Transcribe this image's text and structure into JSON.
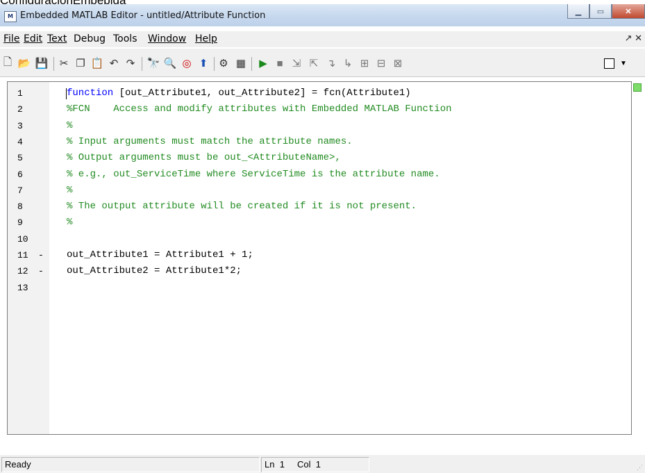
{
  "caption": "ConfiguraciónEmbebida",
  "window": {
    "title": "Embedded MATLAB Editor - untitled/Attribute Function",
    "icon_label": "M",
    "buttons": [
      "minimize-icon",
      "maximize-icon",
      "close-icon"
    ]
  },
  "menu": {
    "items": [
      {
        "label": "File",
        "underline": "F"
      },
      {
        "label": "Edit",
        "underline": "E"
      },
      {
        "label": "Text",
        "underline": "T"
      },
      {
        "label": "Debug",
        "underline": "b"
      },
      {
        "label": "Tools",
        "underline": "o"
      },
      {
        "label": "Window",
        "underline": "W"
      },
      {
        "label": "Help",
        "underline": "H"
      }
    ],
    "undock_label": "↗ ✕"
  },
  "toolbar": {
    "icons": [
      "new-file-icon",
      "open-folder-icon",
      "save-icon",
      "cut-icon",
      "copy-icon",
      "paste-icon",
      "undo-icon",
      "redo-icon",
      "find-icon",
      "find-files-icon",
      "target-icon",
      "go-up-icon",
      "build-icon",
      "data-ports-icon",
      "run-icon",
      "stop-icon",
      "step-in-icon",
      "step-out-icon",
      "step-icon",
      "step-into-icon",
      "breakpoint-icon",
      "clear-breakpoints-icon",
      "exit-debug-icon"
    ]
  },
  "editor": {
    "lines": [
      {
        "num": "1",
        "mark": "",
        "segments": [
          {
            "t": "function",
            "c": "kw"
          },
          {
            "t": " [out_Attribute1, out_Attribute2] = fcn(Attribute1)",
            "c": ""
          }
        ]
      },
      {
        "num": "2",
        "mark": "",
        "segments": [
          {
            "t": "%FCN    Access and modify attributes with Embedded MATLAB Function",
            "c": "cm"
          }
        ]
      },
      {
        "num": "3",
        "mark": "",
        "segments": [
          {
            "t": "%",
            "c": "cm"
          }
        ]
      },
      {
        "num": "4",
        "mark": "",
        "segments": [
          {
            "t": "% Input arguments must match the attribute names.",
            "c": "cm"
          }
        ]
      },
      {
        "num": "5",
        "mark": "",
        "segments": [
          {
            "t": "% Output arguments must be out_<AttributeName>,",
            "c": "cm"
          }
        ]
      },
      {
        "num": "6",
        "mark": "",
        "segments": [
          {
            "t": "% e.g., out_ServiceTime where ServiceTime is the attribute name.",
            "c": "cm"
          }
        ]
      },
      {
        "num": "7",
        "mark": "",
        "segments": [
          {
            "t": "%",
            "c": "cm"
          }
        ]
      },
      {
        "num": "8",
        "mark": "",
        "segments": [
          {
            "t": "% The output attribute will be created if it is not present.",
            "c": "cm"
          }
        ]
      },
      {
        "num": "9",
        "mark": "",
        "segments": [
          {
            "t": "%",
            "c": "cm"
          }
        ]
      },
      {
        "num": "10",
        "mark": "",
        "segments": []
      },
      {
        "num": "11",
        "mark": "-",
        "segments": [
          {
            "t": "out_Attribute1 = Attribute1 + 1;",
            "c": ""
          }
        ]
      },
      {
        "num": "12",
        "mark": "-",
        "segments": [
          {
            "t": "out_Attribute2 = Attribute1*2;",
            "c": ""
          }
        ]
      },
      {
        "num": "13",
        "mark": "",
        "segments": []
      }
    ]
  },
  "status": {
    "ready": "Ready",
    "ln_label": "Ln",
    "ln_value": "1",
    "col_label": "Col",
    "col_value": "1"
  },
  "colors": {
    "keyword": "#0000ff",
    "comment": "#228b22",
    "title_bar": "#c6d8ee",
    "close_button": "#c0492f"
  }
}
